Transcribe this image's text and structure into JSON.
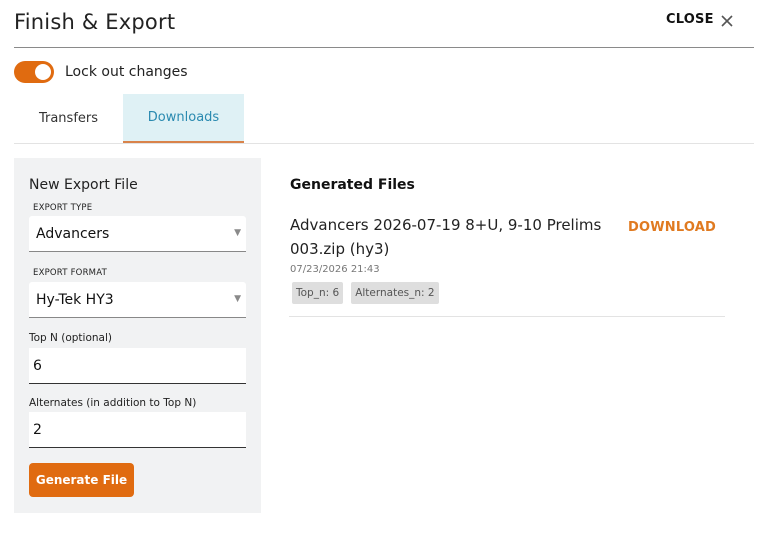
{
  "header": {
    "title": "Finish & Export",
    "close_label": "CLOSE"
  },
  "lock": {
    "label": "Lock out changes",
    "enabled": true
  },
  "tabs": [
    {
      "label": "Transfers",
      "active": false
    },
    {
      "label": "Downloads",
      "active": true
    }
  ],
  "new_export": {
    "title": "New Export File",
    "export_type_caption": "EXPORT TYPE",
    "export_type_value": "Advancers",
    "export_format_caption": "EXPORT FORMAT",
    "export_format_value": "Hy-Tek HY3",
    "top_n_label": "Top N (optional)",
    "top_n_value": "6",
    "alternates_label": "Alternates (in addition to Top N)",
    "alternates_value": "2",
    "generate_label": "Generate File"
  },
  "generated": {
    "heading": "Generated Files",
    "files": [
      {
        "name": "Advancers 2026-07-19 8+U, 9-10 Prelims 003.zip (hy3)",
        "date": "07/23/2026 21:43",
        "download_label": "DOWNLOAD",
        "tags": [
          "Top_n: 6",
          "Alternates_n: 2"
        ]
      }
    ]
  },
  "colors": {
    "accent": "#e06b10",
    "tab_active_bg": "#dff1f5",
    "tab_active_text": "#2a8ab0",
    "download_link": "#e07a20"
  }
}
